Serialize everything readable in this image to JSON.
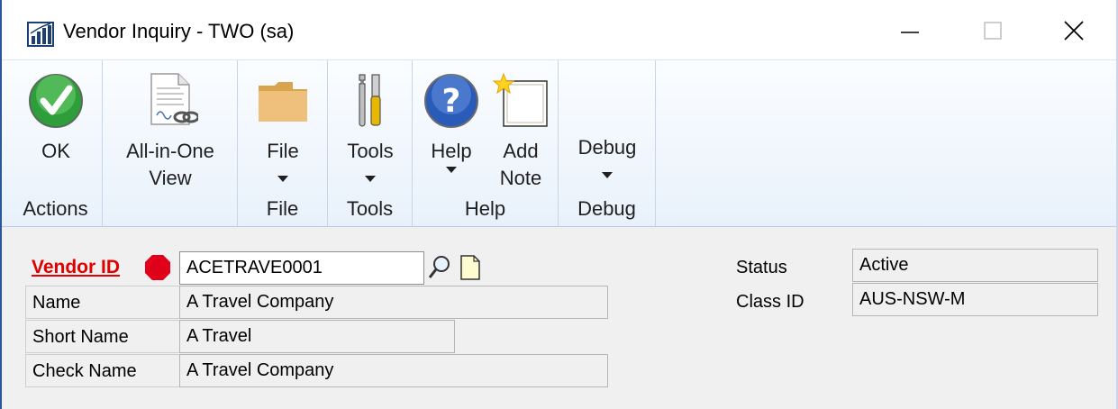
{
  "window": {
    "title": "Vendor Inquiry  -  TWO (sa)",
    "icon": "dynamics-gp-icon",
    "controls": {
      "minimize": "minimize-icon",
      "maximize": "maximize-icon",
      "close": "close-icon"
    }
  },
  "ribbon": {
    "groups": [
      {
        "label": "Actions",
        "buttons": [
          {
            "label": "OK",
            "icon": "checkmark-icon"
          }
        ]
      },
      {
        "label": "",
        "buttons": [
          {
            "label": "All-in-One\nView",
            "icon": "document-link-icon"
          }
        ]
      },
      {
        "label": "File",
        "buttons": [
          {
            "label": "File",
            "icon": "folder-icon",
            "dropdown": true
          }
        ]
      },
      {
        "label": "Tools",
        "buttons": [
          {
            "label": "Tools",
            "icon": "tools-icon",
            "dropdown": true
          }
        ]
      },
      {
        "label": "Help",
        "buttons": [
          {
            "label": "Help",
            "icon": "help-icon",
            "dropdown": true
          },
          {
            "label": "Add\nNote",
            "icon": "add-note-icon"
          }
        ]
      },
      {
        "label": "Debug",
        "buttons": [
          {
            "label": "Debug",
            "icon": "",
            "dropdown": true
          }
        ]
      }
    ]
  },
  "form": {
    "vendor_id": {
      "label": "Vendor ID",
      "value": "ACETRAVE0001"
    },
    "name": {
      "label": "Name",
      "value": "A Travel Company"
    },
    "short_name": {
      "label": "Short Name",
      "value": "A Travel"
    },
    "check_name": {
      "label": "Check Name",
      "value": "A Travel Company"
    },
    "status": {
      "label": "Status",
      "value": "Active"
    },
    "class_id": {
      "label": "Class ID",
      "value": "AUS-NSW-M"
    }
  },
  "colors": {
    "required_label": "#e00000",
    "ribbon_bg": "#e8f1fb",
    "window_border": "#2b579a"
  }
}
